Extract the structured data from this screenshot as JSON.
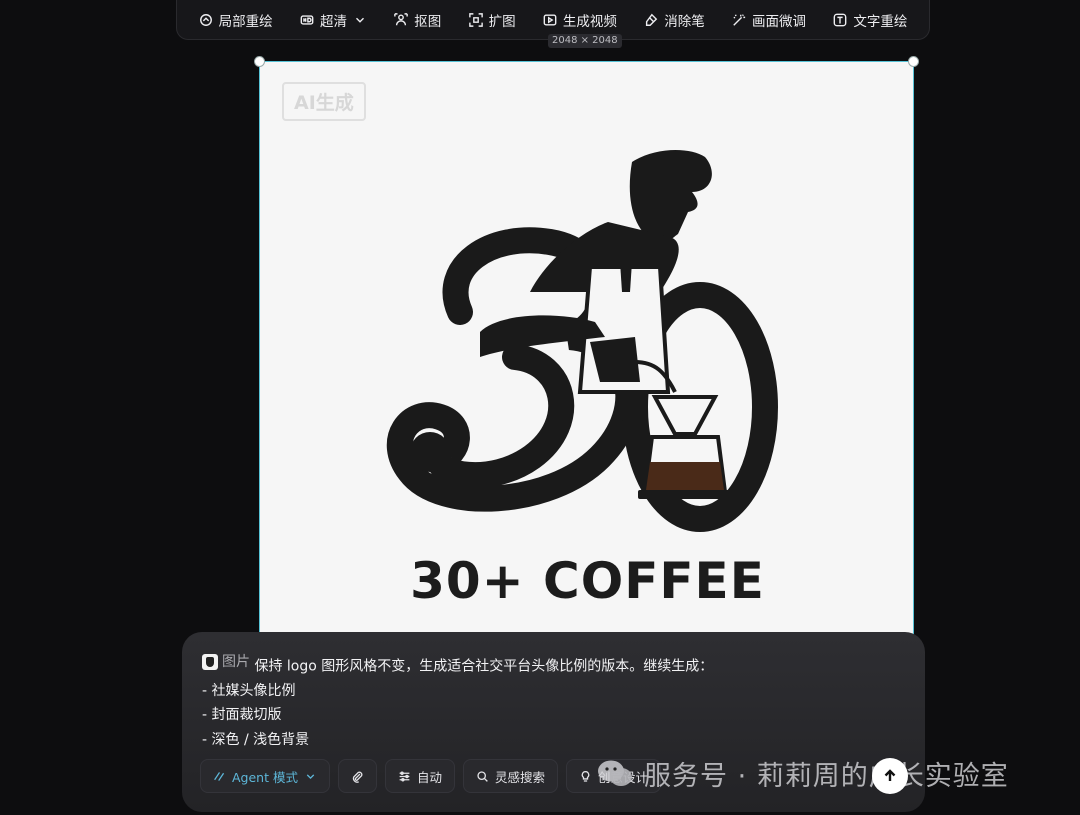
{
  "toolbar": {
    "items": [
      {
        "label": "局部重绘",
        "icon": "inpaint-icon"
      },
      {
        "label": "超清",
        "icon": "hd-icon"
      },
      {
        "label": "抠图",
        "icon": "cutout-icon"
      },
      {
        "label": "扩图",
        "icon": "expand-icon"
      },
      {
        "label": "生成视频",
        "icon": "play-video-icon"
      },
      {
        "label": "消除笔",
        "icon": "eraser-icon"
      },
      {
        "label": "画面微调",
        "icon": "wand-icon"
      },
      {
        "label": "文字重绘",
        "icon": "text-icon"
      }
    ]
  },
  "canvas": {
    "dimensions": "2048 × 2048",
    "watermark": "AI生成",
    "brand_text": "30+ COFFEE",
    "accent_border": "#56c2d6"
  },
  "prompt": {
    "chip_label": "图片",
    "text": "保持 logo 图形风格不变，生成适合社交平台头像比例的版本。继续生成：",
    "lines": [
      "- 社媒头像比例",
      "- 封面裁切版",
      "- 深色 / 浅色背景"
    ]
  },
  "actions": {
    "agent": "Agent 模式",
    "auto": "自动",
    "inspiration": "灵感搜索",
    "creative": "创意设计"
  },
  "watermark": {
    "text": "服务号 · 莉莉周的成长实验室"
  }
}
